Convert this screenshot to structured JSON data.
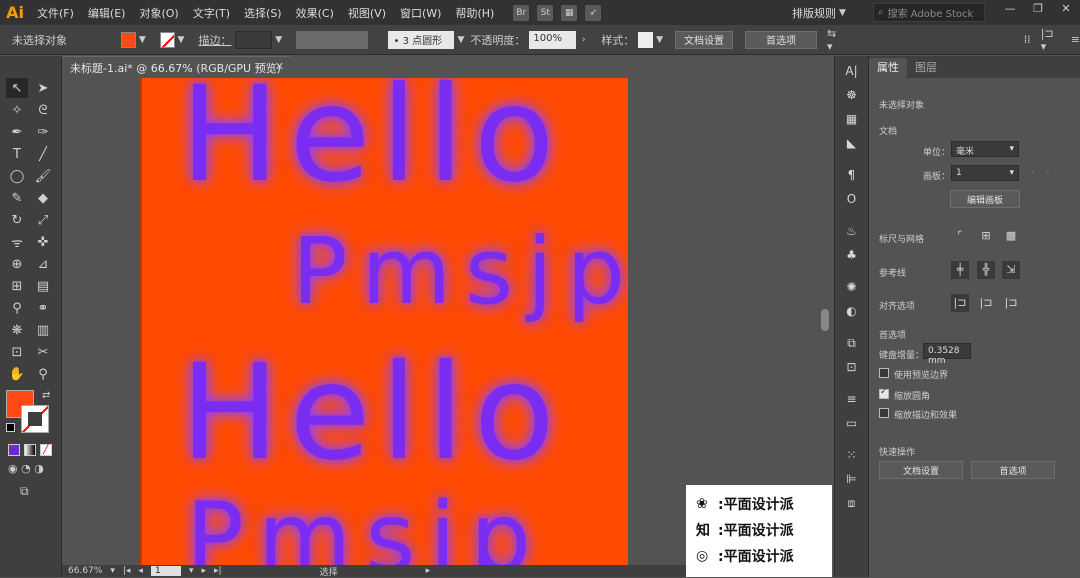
{
  "menubar": {
    "logo": "Ai",
    "items": [
      "文件(F)",
      "编辑(E)",
      "对象(O)",
      "文字(T)",
      "选择(S)",
      "效果(C)",
      "视图(V)",
      "窗口(W)",
      "帮助(H)"
    ],
    "workspace": "排版规则",
    "stock_search_placeholder": "搜索 Adobe Stock"
  },
  "control": {
    "selection_label": "未选择对象",
    "stroke_label": "描边：",
    "brush": "• 3 点圆形",
    "opacity_label": "不透明度：",
    "opacity_value": "100%",
    "style_label": "样式：",
    "doc_setup": "文档设置",
    "preferences": "首选项",
    "fill_color": "#ff4a14"
  },
  "document": {
    "tab_title": "未标题-1.ai* @ 66.67% (RGB/GPU 预览)",
    "artboard_color": "#ff4a00",
    "text_color": "#7a2cf0",
    "lines": [
      "Hello",
      "Pmsjp",
      "Hello",
      "Pmsjp"
    ]
  },
  "status": {
    "zoom": "66.67%",
    "artboard": "1",
    "tool": "选择"
  },
  "properties": {
    "tabs": [
      "属性",
      "图层"
    ],
    "no_selection": "未选择对象",
    "document_header": "文档",
    "units_label": "单位：",
    "units_value": "毫米",
    "artboard_label": "画板：",
    "artboard_value": "1",
    "edit_artboards": "编辑画板",
    "rulers_grids": "标尺与网格",
    "guides": "参考线",
    "align_options": "对齐选项",
    "preferences_header": "首选项",
    "keyboard_increment_label": "键盘增量：",
    "keyboard_increment_value": "0.3528 mm",
    "use_preview_bounds": "使用预览边界",
    "scale_corners": "缩放圆角",
    "scale_strokes": "缩放描边和效果",
    "quick_actions": "快速操作",
    "qa_doc_setup": "文档设置",
    "qa_preferences": "首选项"
  },
  "watermark": {
    "lines": [
      ":平面设计派",
      ":平面设计派",
      ":平面设计派"
    ],
    "icons": [
      "wechat-icon",
      "zhihu-icon",
      "weibo-icon"
    ]
  }
}
